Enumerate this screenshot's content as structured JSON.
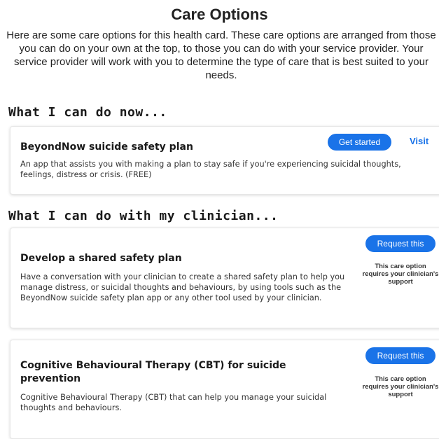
{
  "header": {
    "title": "Care Options",
    "intro": "Here are some care options for this health card. These care options are arranged from those you can do on your own at the top, to those you can do with your service provider. Your service provider will work with you to determine the type of care that is best suited to your needs."
  },
  "sections": {
    "self": {
      "heading": "What I can do now...",
      "items": [
        {
          "title": "BeyondNow suicide safety plan",
          "description": "An app that assists you with making a plan to stay safe if you're experiencing suicidal thoughts, feelings, distress or crisis. (FREE)",
          "primary_button": "Get started",
          "secondary_link": "Visit"
        }
      ]
    },
    "clinician": {
      "heading": "What I can do with my clinician...",
      "items": [
        {
          "title": "Develop a shared safety plan",
          "description": "Have a conversation with your clinician to create a shared safety plan to help you manage distress, or suicidal thoughts and behaviours, by using tools such as the BeyondNow suicide safety plan app or any other tool used by your clinician.",
          "button": "Request this",
          "note": "This care option requires your clinician's support"
        },
        {
          "title": "Cognitive Behavioural Therapy (CBT) for suicide prevention",
          "description": "Cognitive Behavioural Therapy (CBT) that can help you manage your suicidal thoughts and behaviours.",
          "button": "Request this",
          "note": "This care option requires your clinician's support"
        }
      ]
    }
  },
  "colors": {
    "accent": "#1a73e8",
    "text": "#1f1f1f"
  }
}
